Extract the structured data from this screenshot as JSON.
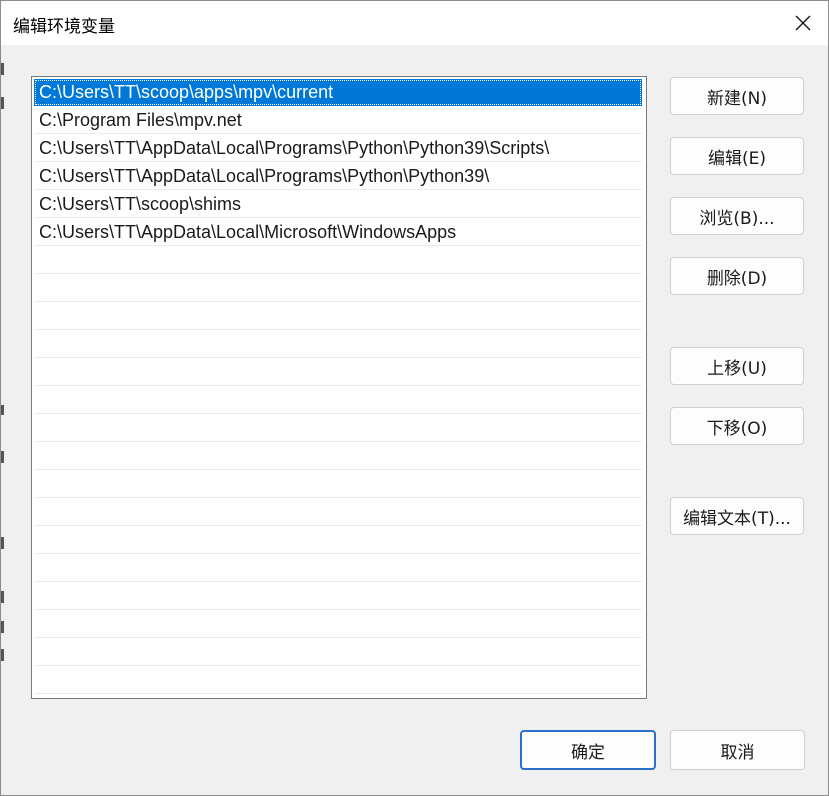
{
  "window": {
    "title": "编辑环境变量"
  },
  "paths": [
    "C:\\Users\\TT\\scoop\\apps\\mpv\\current",
    "C:\\Program Files\\mpv.net",
    "C:\\Users\\TT\\AppData\\Local\\Programs\\Python\\Python39\\Scripts\\",
    "C:\\Users\\TT\\AppData\\Local\\Programs\\Python\\Python39\\",
    "C:\\Users\\TT\\scoop\\shims",
    "C:\\Users\\TT\\AppData\\Local\\Microsoft\\WindowsApps"
  ],
  "selected_index": 0,
  "buttons": {
    "new": "新建(N)",
    "edit": "编辑(E)",
    "browse": "浏览(B)...",
    "delete": "删除(D)",
    "move_up": "上移(U)",
    "move_down": "下移(O)",
    "edit_text": "编辑文本(T)...",
    "ok": "确定",
    "cancel": "取消"
  },
  "colors": {
    "selection": "#0078d7",
    "primary_border": "#2a70c8"
  }
}
